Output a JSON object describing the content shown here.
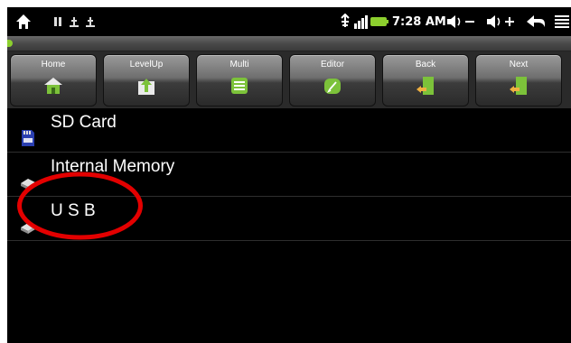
{
  "status_bar": {
    "time": "7:28 AM",
    "icons": [
      "home-icon",
      "notification-icons",
      "usb-storage-icon",
      "signal-icon",
      "battery-icon",
      "volume-down-icon",
      "volume-up-icon",
      "back-icon",
      "menu-icon"
    ]
  },
  "toolbar": {
    "buttons": [
      {
        "label": "Home",
        "icon": "home-icon"
      },
      {
        "label": "LevelUp",
        "icon": "level-up-icon"
      },
      {
        "label": "Multi",
        "icon": "multi-select-icon"
      },
      {
        "label": "Editor",
        "icon": "editor-icon"
      },
      {
        "label": "Back",
        "icon": "back-exit-icon"
      },
      {
        "label": "Next",
        "icon": "next-exit-icon"
      }
    ]
  },
  "storage_list": [
    {
      "label": "SD Card",
      "icon": "sd-card-icon"
    },
    {
      "label": "Internal Memory",
      "icon": "internal-memory-icon"
    },
    {
      "label": "U S B",
      "icon": "usb-drive-icon"
    }
  ],
  "colors": {
    "background": "#000000",
    "accent_green": "#8ccf2e",
    "annotation_red": "#e30000"
  }
}
